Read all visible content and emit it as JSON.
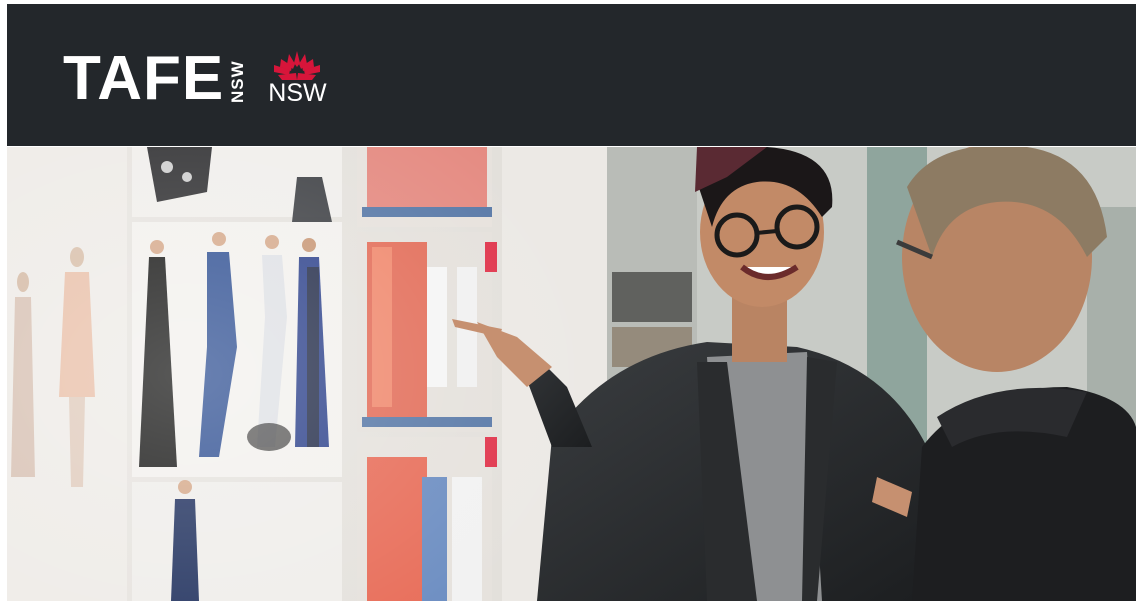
{
  "header": {
    "logo_main": "TAFE",
    "logo_vertical": "NSW",
    "logo_waratah": "waratah-icon",
    "logo_nsw": "NSW",
    "background": "#23272b",
    "waratah_color": "#d7153a"
  },
  "hero": {
    "subject": "photo"
  }
}
